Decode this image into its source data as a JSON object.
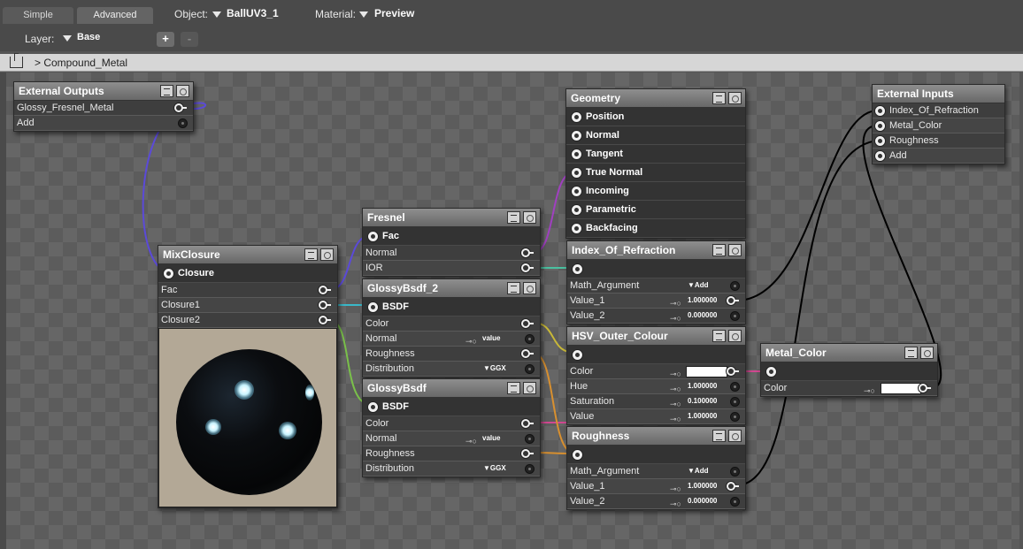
{
  "toolbar": {
    "tabs": [
      "Simple",
      "Advanced"
    ],
    "object_label": "Object:",
    "object_value": "BallUV3_1",
    "material_label": "Material:",
    "material_value": "Preview",
    "layer_label": "Layer:",
    "layer_value": "Base",
    "add_label": "+",
    "remove_label": "-"
  },
  "breadcrumb": {
    "text": "> Compound_Metal"
  },
  "nodes": {
    "external_outputs": {
      "title": "External Outputs",
      "rows": [
        "Glossy_Fresnel_Metal",
        "Add"
      ]
    },
    "external_inputs": {
      "title": "External Inputs",
      "rows": [
        "Index_Of_Refraction",
        "Metal_Color",
        "Roughness",
        "Add"
      ]
    },
    "mixclosure": {
      "title": "MixClosure",
      "output": "Closure",
      "rows": [
        "Fac",
        "Closure1",
        "Closure2"
      ]
    },
    "fresnel": {
      "title": "Fresnel",
      "output": "Fac",
      "rows": [
        "Normal",
        "IOR"
      ]
    },
    "glossy2": {
      "title": "GlossyBsdf_2",
      "output": "BSDF",
      "rows": [
        "Color",
        "Normal",
        "Roughness",
        "Distribution"
      ],
      "normal_value": "value",
      "distribution_value": "GGX"
    },
    "glossy": {
      "title": "GlossyBsdf",
      "output": "BSDF",
      "rows": [
        "Color",
        "Normal",
        "Roughness",
        "Distribution"
      ],
      "normal_value": "value",
      "distribution_value": "GGX"
    },
    "geometry": {
      "title": "Geometry",
      "outputs": [
        "Position",
        "Normal",
        "Tangent",
        "True Normal",
        "Incoming",
        "Parametric",
        "Backfacing"
      ]
    },
    "ior": {
      "title": "Index_Of_Refraction",
      "rows": [
        "Math_Argument",
        "Value_1",
        "Value_2"
      ],
      "argument": "Add",
      "value1": "1.000000",
      "value2": "0.000000"
    },
    "hsv": {
      "title": "HSV_Outer_Colour",
      "rows": [
        "Color",
        "Hue",
        "Saturation",
        "Value"
      ],
      "hue": "1.000000",
      "saturation": "0.100000",
      "value": "1.000000"
    },
    "roughness": {
      "title": "Roughness",
      "rows": [
        "Math_Argument",
        "Value_1",
        "Value_2"
      ],
      "argument": "Add",
      "value1": "1.000000",
      "value2": "0.000000"
    },
    "metal_color": {
      "title": "Metal_Color",
      "rows": [
        "Color"
      ]
    }
  },
  "colors": {
    "wire_blue": "#5b4ad8",
    "wire_cyan": "#3ab8c8",
    "wire_green": "#7ac04a",
    "wire_purple": "#a040c0",
    "wire_mint": "#4ac0a0",
    "wire_yellow": "#c8b838",
    "wire_pink": "#d04890",
    "wire_orange": "#d89030",
    "wire_black": "#000000"
  }
}
